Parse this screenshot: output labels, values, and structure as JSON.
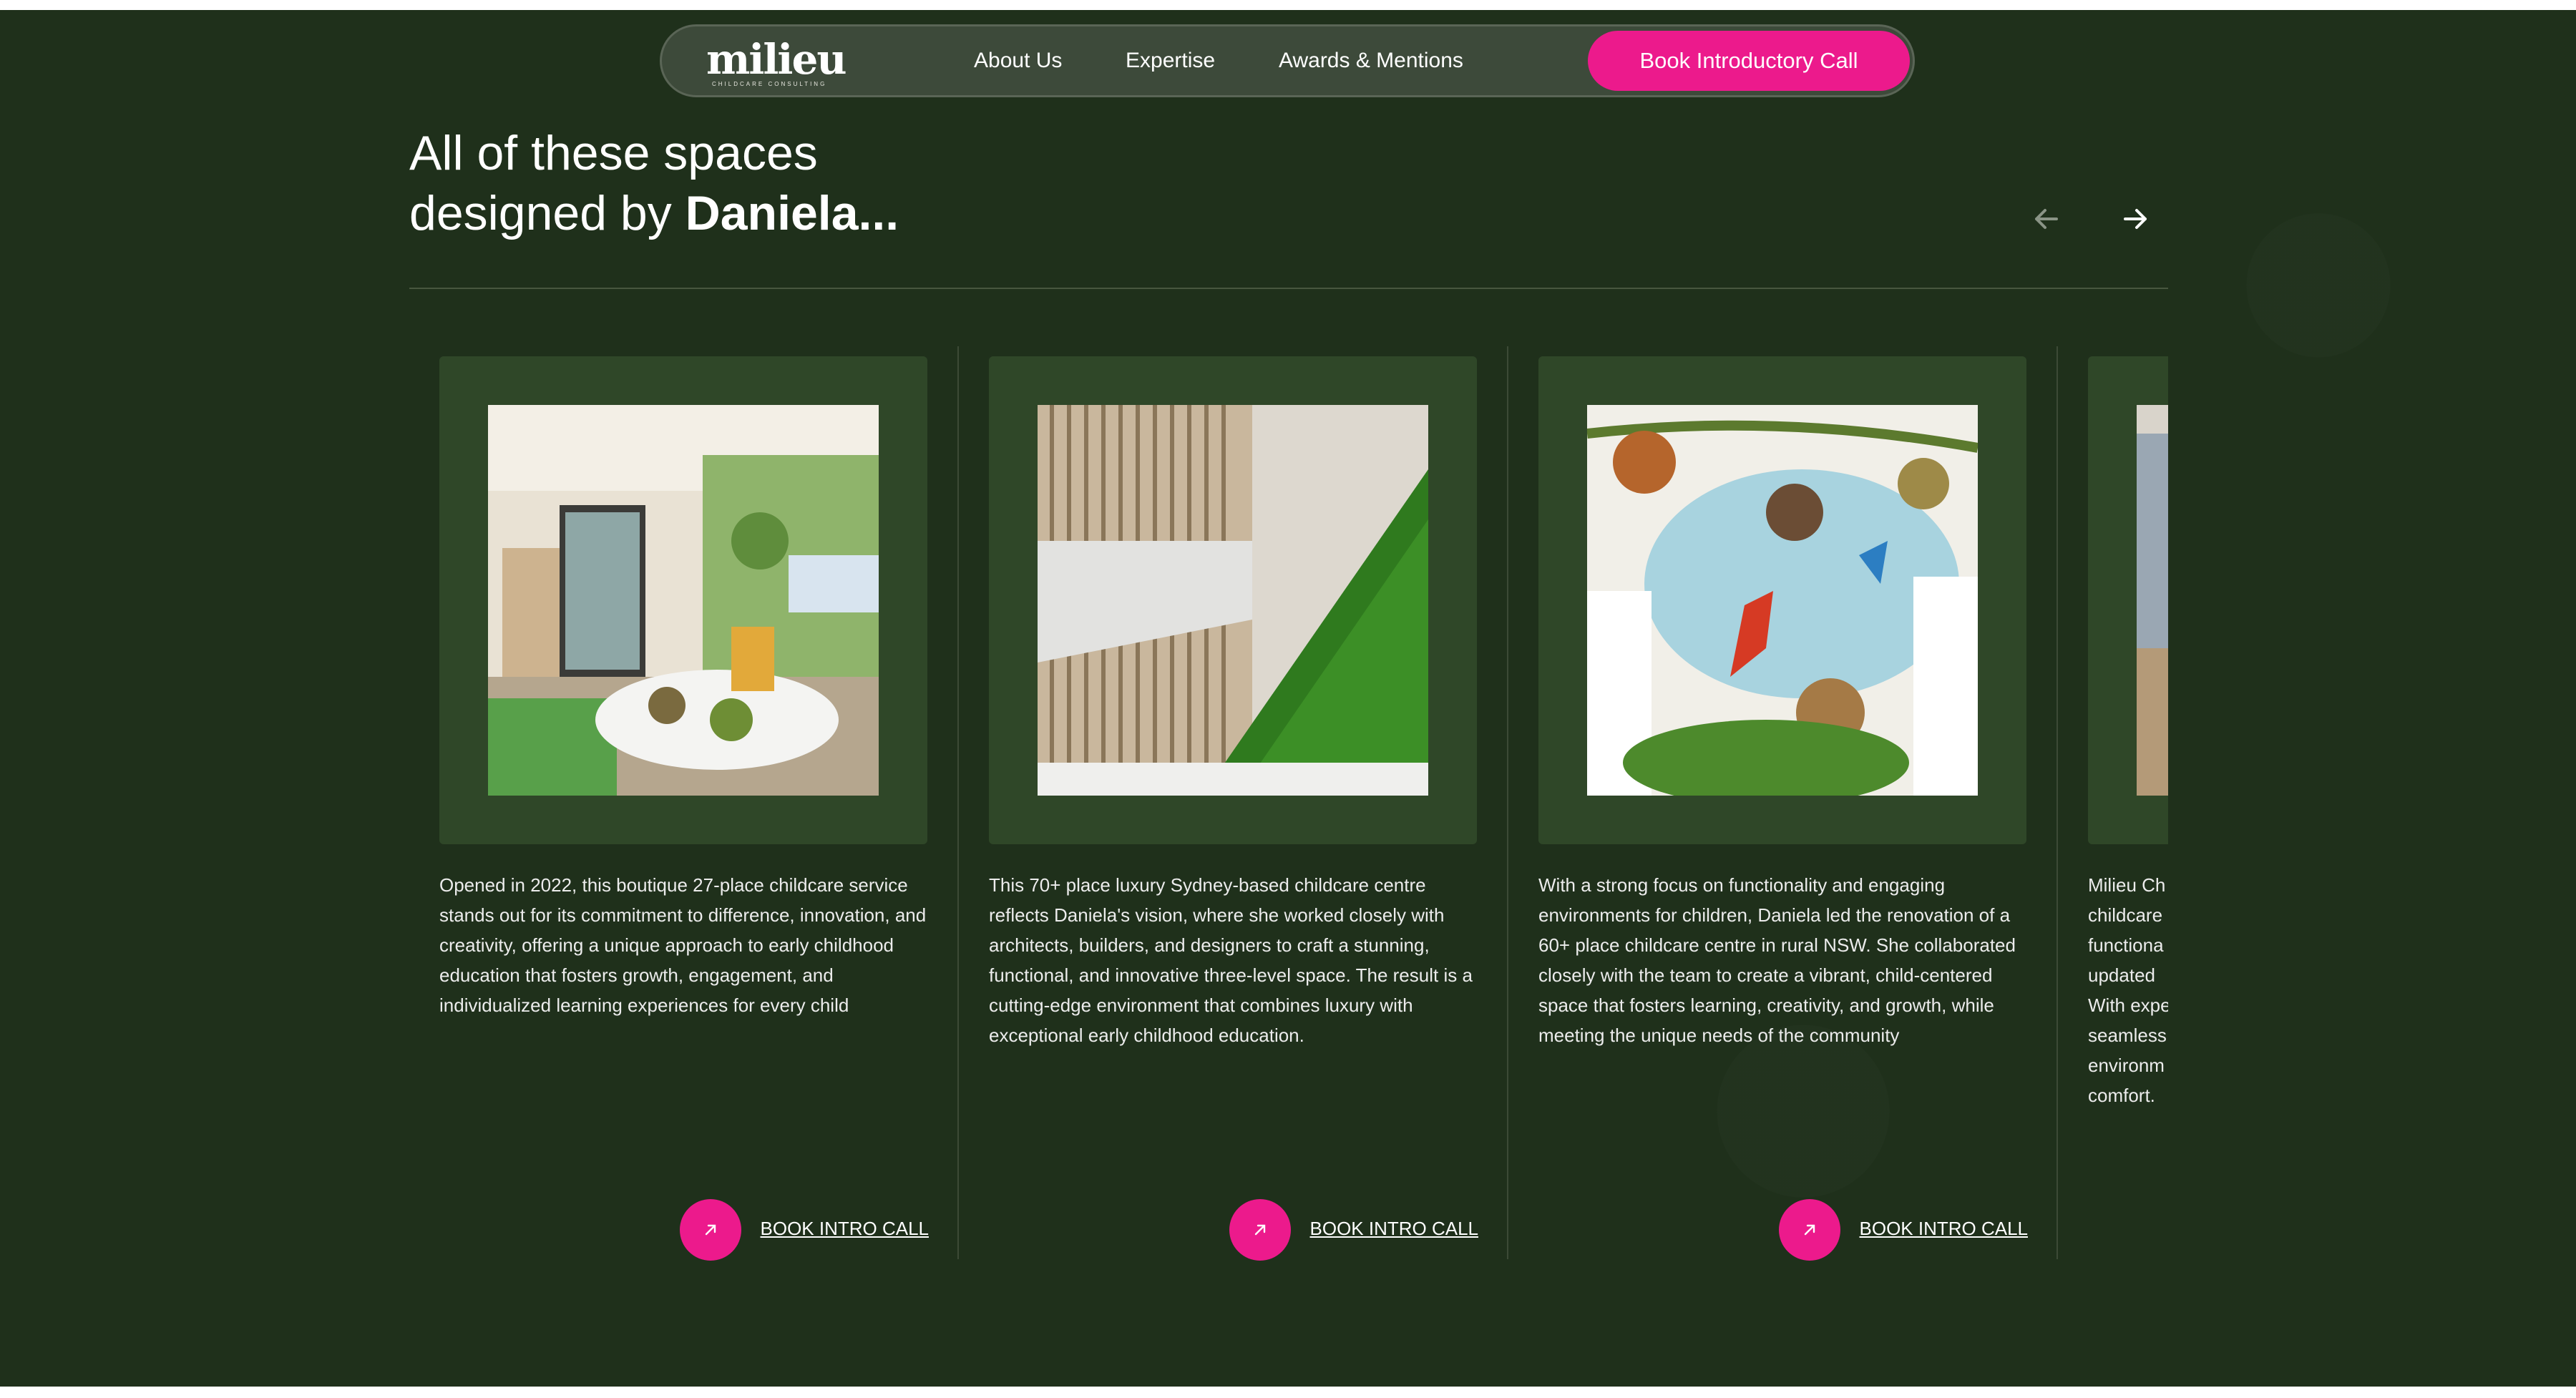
{
  "nav": {
    "logo_text": "milieu",
    "logo_sub": "CHILDCARE CONSULTING",
    "links": [
      "About Us",
      "Expertise",
      "Awards & Mentions"
    ],
    "cta": "Book Introductory Call"
  },
  "section": {
    "title_line1": "All of these spaces",
    "title_line2_prefix": "designed by ",
    "title_line2_bold": "Daniela..."
  },
  "carousel": {
    "prev_icon": "arrow-left-icon",
    "next_icon": "arrow-right-icon",
    "cards": [
      {
        "image": "childcare-classroom-photo",
        "description": "Opened in 2022, this boutique 27-place childcare service stands out for its commitment to difference, innovation, and creativity, offering a unique approach to early childhood education that fosters growth, engagement, and individualized learning experiences for every child",
        "cta": "BOOK INTRO CALL"
      },
      {
        "image": "green-wall-reception-photo",
        "description": "This 70+ place luxury Sydney-based childcare centre reflects Daniela's vision, where she worked closely with architects, builders, and designers to craft a stunning, functional, and innovative three-level space. The result is a cutting-edge environment that combines luxury with exceptional early childhood education.",
        "cta": "BOOK INTRO CALL"
      },
      {
        "image": "jungle-mural-photo",
        "description": "With a strong focus on functionality and engaging environments for children, Daniela led the renovation of a 60+ place childcare centre in rural NSW. She collaborated closely with the team to create a vibrant, child-centered space that fosters learning, creativity, and growth, while meeting the unique needs of the community",
        "cta": "BOOK INTRO CALL"
      },
      {
        "image": "partial-room-photo",
        "description_lines": [
          "Milieu Ch",
          "childcare",
          "functiona",
          "updated",
          "With expe",
          "seamless,",
          "environm",
          "comfort."
        ]
      }
    ]
  },
  "colors": {
    "background": "#1f301b",
    "accent": "#ec1a8c",
    "frame": "#2f4728",
    "nav_bg": "#3d4a3a"
  }
}
